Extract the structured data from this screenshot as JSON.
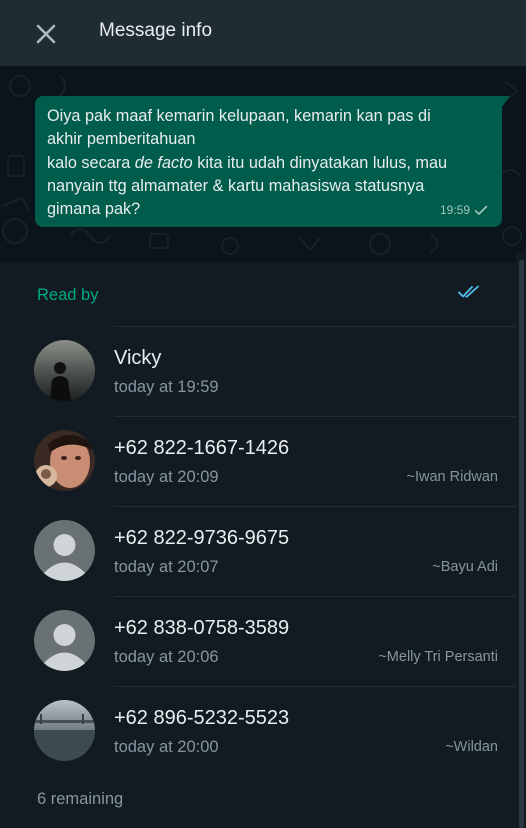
{
  "header": {
    "title": "Message info",
    "close_icon": "close-icon"
  },
  "message": {
    "lines": [
      "Oiya pak maaf kemarin kelupaan, kemarin kan pas di",
      "akhir pemberitahuan"
    ],
    "line3_prefix": "kalo secara ",
    "line3_italic": "de facto",
    "line3_suffix": " kita itu udah dinyatakan lulus, mau",
    "line4": "nanyain ttg almamater & kartu mahasiswa statusnya",
    "line5": "gimana pak?",
    "time": "19:59",
    "status_icon": "single-check-icon"
  },
  "read_by": {
    "label": "Read by",
    "icon": "double-check-icon",
    "accent_color": "#00a884",
    "tick_color": "#53bdeb"
  },
  "contacts": [
    {
      "name": "Vicky",
      "time": "today at 19:59",
      "alias": "",
      "avatar": "photo-avatar"
    },
    {
      "name": "+62 822-1667-1426",
      "time": "today at 20:09",
      "alias": "~Iwan Ridwan",
      "avatar": "photo-avatar"
    },
    {
      "name": "+62 822-9736-9675",
      "time": "today at 20:07",
      "alias": "~Bayu Adi",
      "avatar": "default-avatar"
    },
    {
      "name": "+62 838-0758-3589",
      "time": "today at 20:06",
      "alias": "~Melly Tri Persanti",
      "avatar": "default-avatar"
    },
    {
      "name": "+62 896-5232-5523",
      "time": "today at 20:00",
      "alias": "~Wildan",
      "avatar": "photo-avatar"
    }
  ],
  "remaining": "6 remaining",
  "colors": {
    "header_bg": "#202c33",
    "panel_bg": "#111b21",
    "bubble_bg": "#005c4b"
  }
}
